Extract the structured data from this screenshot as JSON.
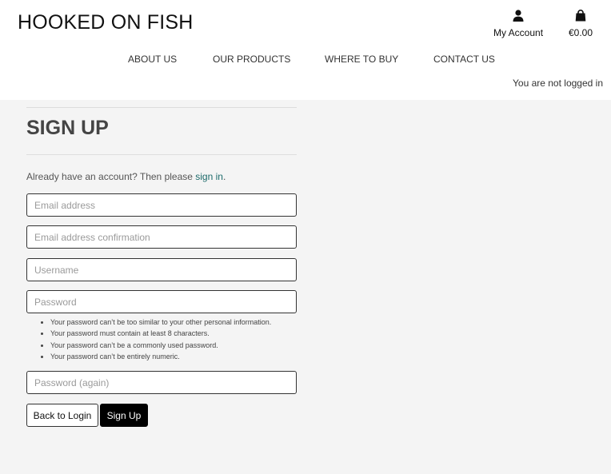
{
  "header": {
    "logo": "HOOKED ON FISH",
    "account_label": "My Account",
    "cart_total": "€0.00",
    "login_status": "You are not logged in"
  },
  "nav": {
    "items": [
      {
        "label": "ABOUT US"
      },
      {
        "label": "OUR PRODUCTS"
      },
      {
        "label": "WHERE TO BUY"
      },
      {
        "label": "CONTACT US"
      }
    ]
  },
  "signup": {
    "title": "SIGN UP",
    "prompt_prefix": "Already have an account? Then please ",
    "prompt_link": "sign in",
    "prompt_suffix": ".",
    "fields": {
      "email": {
        "placeholder": "Email address",
        "value": ""
      },
      "email_confirm": {
        "placeholder": "Email address confirmation",
        "value": ""
      },
      "username": {
        "placeholder": "Username",
        "value": ""
      },
      "password": {
        "placeholder": "Password",
        "value": ""
      },
      "password_again": {
        "placeholder": "Password (again)",
        "value": ""
      }
    },
    "password_rules": [
      "Your password can’t be too similar to your other personal information.",
      "Your password must contain at least 8 characters.",
      "Your password can’t be a commonly used password.",
      "Your password can’t be entirely numeric."
    ],
    "back_button": "Back to Login",
    "signup_button": "Sign Up"
  },
  "icons": {
    "account": "person-icon",
    "cart": "shopping-bag-icon"
  },
  "colors": {
    "link": "#1d6b6b",
    "primary_button": "#000000",
    "page_background": "#f4f4f4"
  }
}
